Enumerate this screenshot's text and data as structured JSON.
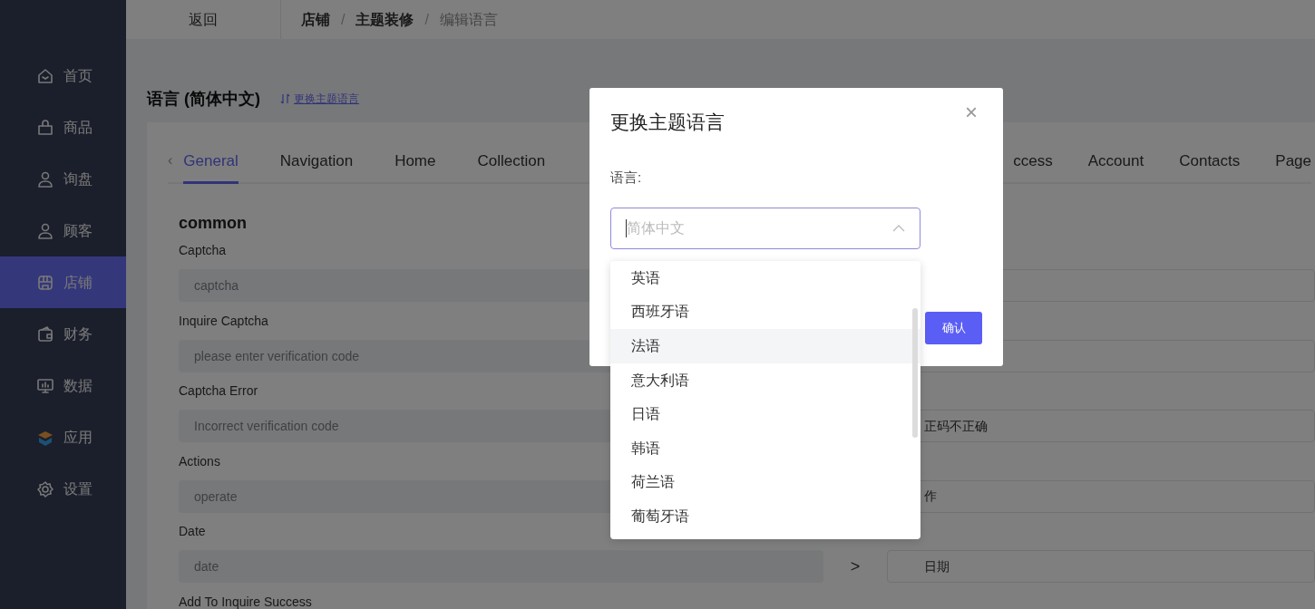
{
  "sidebar": {
    "items": [
      {
        "label": "首页",
        "selected": false
      },
      {
        "label": "商品",
        "selected": false
      },
      {
        "label": "询盘",
        "selected": false
      },
      {
        "label": "顾客",
        "selected": false
      },
      {
        "label": "店铺",
        "selected": true
      },
      {
        "label": "财务",
        "selected": false
      },
      {
        "label": "数据",
        "selected": false
      },
      {
        "label": "应用",
        "selected": false
      },
      {
        "label": "设置",
        "selected": false
      }
    ]
  },
  "topbar": {
    "back": "返回",
    "separator": "/",
    "breadcrumb": [
      {
        "label": "店铺",
        "current": false
      },
      {
        "label": "主题装修",
        "current": false
      },
      {
        "label": "编辑语言",
        "current": true
      }
    ]
  },
  "page": {
    "title": "语言 (简体中文)",
    "switch_link": "更换主题语言"
  },
  "tabs": {
    "scroll_left": "‹",
    "left": [
      {
        "label": "General",
        "selected": true
      },
      {
        "label": "Navigation",
        "selected": false
      },
      {
        "label": "Home",
        "selected": false
      },
      {
        "label": "Collection",
        "selected": false
      }
    ],
    "right": [
      {
        "label": "ccess",
        "selected": false
      },
      {
        "label": "Account",
        "selected": false
      },
      {
        "label": "Contacts",
        "selected": false
      },
      {
        "label": "Page",
        "selected": false
      }
    ]
  },
  "section": {
    "title": "common",
    "rows": [
      {
        "label": "Captcha",
        "placeholder": "captcha"
      },
      {
        "label": "Inquire Captcha",
        "placeholder": "please enter verification code"
      },
      {
        "label": "Captcha Error",
        "placeholder": "Incorrect verification code",
        "value": "正码不正确"
      },
      {
        "label": "Actions",
        "placeholder": "operate",
        "value": "作"
      },
      {
        "label": "Date",
        "placeholder": "date",
        "arrow": ">",
        "value": "日期"
      },
      {
        "label": "Add To Inquire Success"
      }
    ]
  },
  "dialog": {
    "title": "更换主题语言",
    "close": "×",
    "field_label": "语言:",
    "select": {
      "placeholder": "简体中文",
      "expanded": true
    },
    "confirm": "确认",
    "options": [
      {
        "label": "英语",
        "hovered": false
      },
      {
        "label": "西班牙语",
        "hovered": false
      },
      {
        "label": "法语",
        "hovered": true
      },
      {
        "label": "意大利语",
        "hovered": false
      },
      {
        "label": "日语",
        "hovered": false
      },
      {
        "label": "韩语",
        "hovered": false
      },
      {
        "label": "荷兰语",
        "hovered": false
      },
      {
        "label": "葡萄牙语",
        "hovered": false
      }
    ]
  }
}
